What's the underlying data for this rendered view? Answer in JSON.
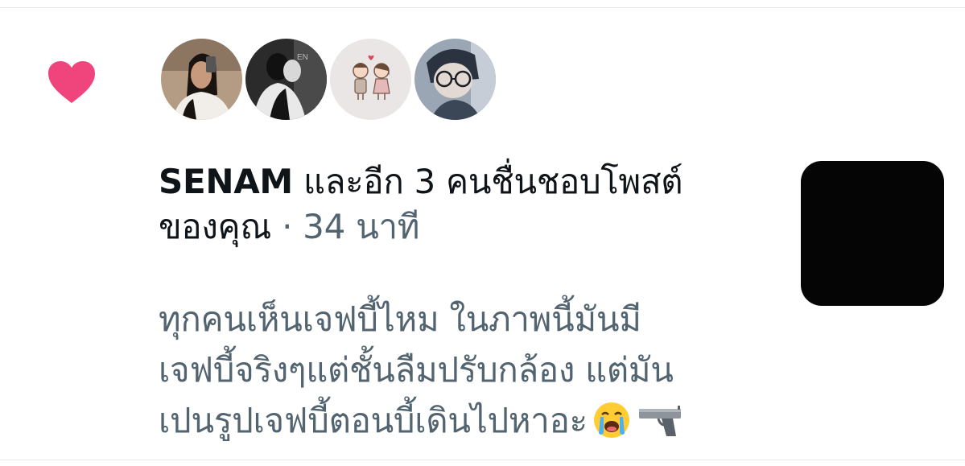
{
  "notification": {
    "type_icon": "heart-icon",
    "accent_color": "#f0447d",
    "avatars": [
      "avatar-woman-selfie",
      "avatar-couple-bw",
      "avatar-cartoon-couple",
      "avatar-anime-glasses"
    ],
    "name": "SENAM",
    "action_line1": " และอีก 3 คนชื่นชอบโพสต์",
    "action_line2": "ของคุณ",
    "separator": " · ",
    "time": "34 นาที"
  },
  "post": {
    "line1": "ทุกคนเห็นเจฟบี้ไหม ในภาพนี้มันมี",
    "line2": "เจฟบี้จริงๆแต่ชั้นลืมปรับกล้อง แต่มัน",
    "line3": "เปนรูปเจฟบี้ตอนบี้เดินไปหาอะ",
    "emojis": [
      "crying-face-emoji",
      "pistol-emoji"
    ]
  },
  "thumbnail": {
    "icon": "black-photo-thumbnail"
  }
}
